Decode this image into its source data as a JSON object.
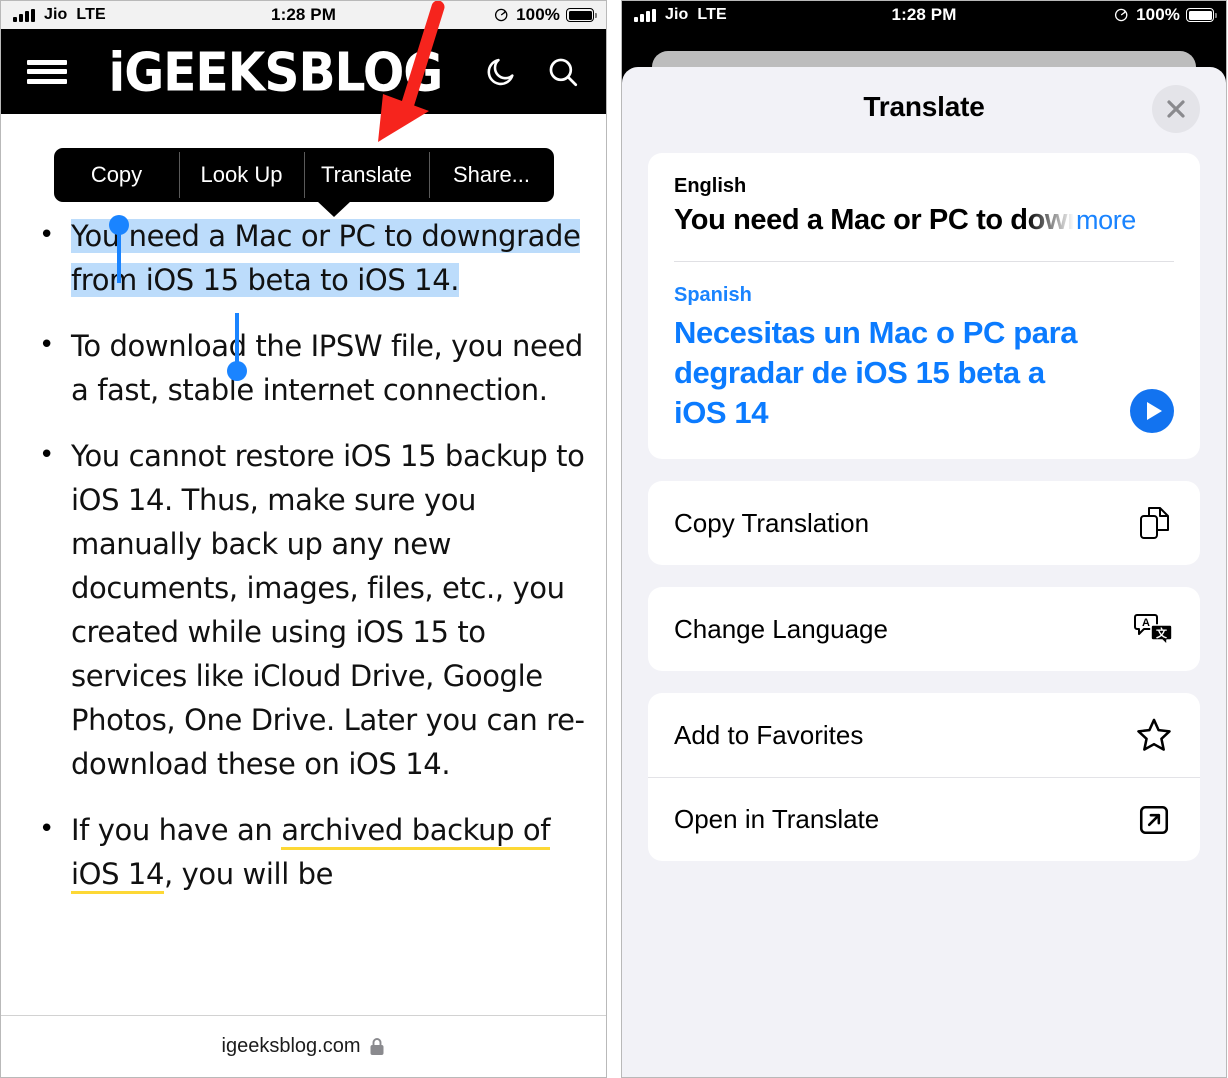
{
  "left_phone": {
    "status_bar": {
      "carrier": "Jio",
      "network": "LTE",
      "time": "1:28 PM",
      "battery_percent": "100%",
      "signal_icon": "signal-bars-icon",
      "location_icon": "location-arrow-icon",
      "battery_icon": "battery-full-icon"
    },
    "site_header": {
      "menu_icon": "hamburger-menu-icon",
      "logo_text": "iGEEKSBLOG",
      "dark_mode_icon": "moon-icon",
      "search_icon": "search-icon"
    },
    "context_menu": {
      "items": [
        {
          "label": "Copy",
          "name": "ctx-copy"
        },
        {
          "label": "Look Up",
          "name": "ctx-look-up"
        },
        {
          "label": "Translate",
          "name": "ctx-translate"
        },
        {
          "label": "Share...",
          "name": "ctx-share"
        }
      ]
    },
    "article": {
      "bullets": [
        {
          "selected": true,
          "text": "You need a Mac or PC to downgrade from iOS 15 beta to iOS 14."
        },
        {
          "selected": false,
          "text": "To download the IPSW file, you need a fast, stable internet connection."
        },
        {
          "selected": false,
          "text": "You cannot restore iOS 15 backup to iOS 14. Thus, make sure you manually back up any new documents, images, files, etc., you created while using iOS 15 to services like iCloud Drive, Google Photos, One Drive. Later you can re-download these on iOS 14."
        },
        {
          "selected": false,
          "prefix": "If you have an ",
          "link": "archived backup of iOS 14",
          "suffix": ", you will be"
        }
      ]
    },
    "url_bar": {
      "domain": "igeeksblog.com",
      "lock_icon": "lock-icon"
    },
    "annotation": {
      "arrow_color": "#f6241d",
      "arrow_name": "red-arrow-pointing-to-translate"
    }
  },
  "right_phone": {
    "status_bar": {
      "carrier": "Jio",
      "network": "LTE",
      "time": "1:28 PM",
      "battery_percent": "100%",
      "signal_icon": "signal-bars-icon",
      "location_icon": "location-arrow-icon",
      "battery_icon": "battery-full-icon"
    },
    "sheet": {
      "title": "Translate",
      "close_icon": "close-x-icon",
      "translation_card": {
        "source_language": "English",
        "source_text": "You need a Mac or PC to down",
        "more_label": "more",
        "target_language": "Spanish",
        "target_text": "Necesitas un Mac o PC para degradar de iOS 15 beta a iOS 14",
        "play_icon": "play-audio-icon"
      },
      "actions_group_1": [
        {
          "label": "Copy Translation",
          "icon": "copy-documents-icon"
        },
        {
          "label": "Change Language",
          "icon": "change-language-icon"
        }
      ],
      "actions_group_2": [
        {
          "label": "Add to Favorites",
          "icon": "star-outline-icon"
        },
        {
          "label": "Open in Translate",
          "icon": "open-external-icon"
        }
      ]
    }
  },
  "colors": {
    "accent_blue": "#1a84ff",
    "translation_blue": "#0b7bff",
    "selection_blue": "#bcdcfb",
    "sheet_bg": "#f2f2f7",
    "arrow_red": "#f6241d",
    "link_underline_yellow": "#fdd835"
  }
}
